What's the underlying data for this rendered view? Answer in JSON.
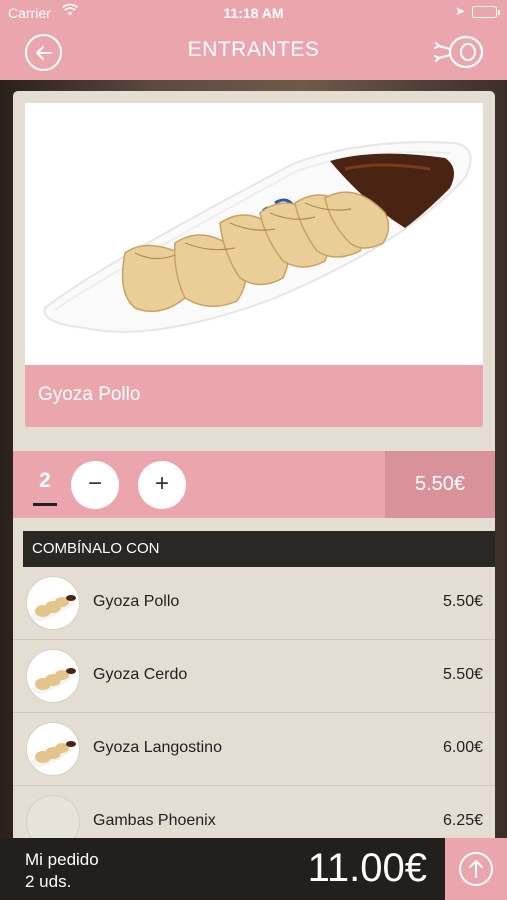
{
  "status_bar": {
    "carrier": "Carrier",
    "time": "11:18 AM"
  },
  "nav": {
    "title": "ENTRANTES",
    "back_icon": "back-arrow-circle-icon",
    "menu_icon": "ham-icon"
  },
  "product": {
    "name": "Gyoza Pollo",
    "quantity": "2",
    "price": "5.50€"
  },
  "qty_controls": {
    "minus_label": "−",
    "plus_label": "+"
  },
  "combine": {
    "header": "COMBÍNALO CON",
    "items": [
      {
        "name": "Gyoza Pollo",
        "price": "5.50€"
      },
      {
        "name": "Gyoza Cerdo",
        "price": "5.50€"
      },
      {
        "name": "Gyoza Langostino",
        "price": "6.00€"
      },
      {
        "name": "Gambas Phoenix",
        "price": "6.25€"
      }
    ]
  },
  "footer": {
    "order_label": "Mi pedido",
    "order_count": "2 uds.",
    "total": "11.00€",
    "up_icon": "arrow-up-circle-icon"
  },
  "colors": {
    "brand_pink": "#eaa6ac",
    "price_pink": "#d9929a",
    "card_beige": "#e3ddd2",
    "dark": "#231f1d"
  }
}
